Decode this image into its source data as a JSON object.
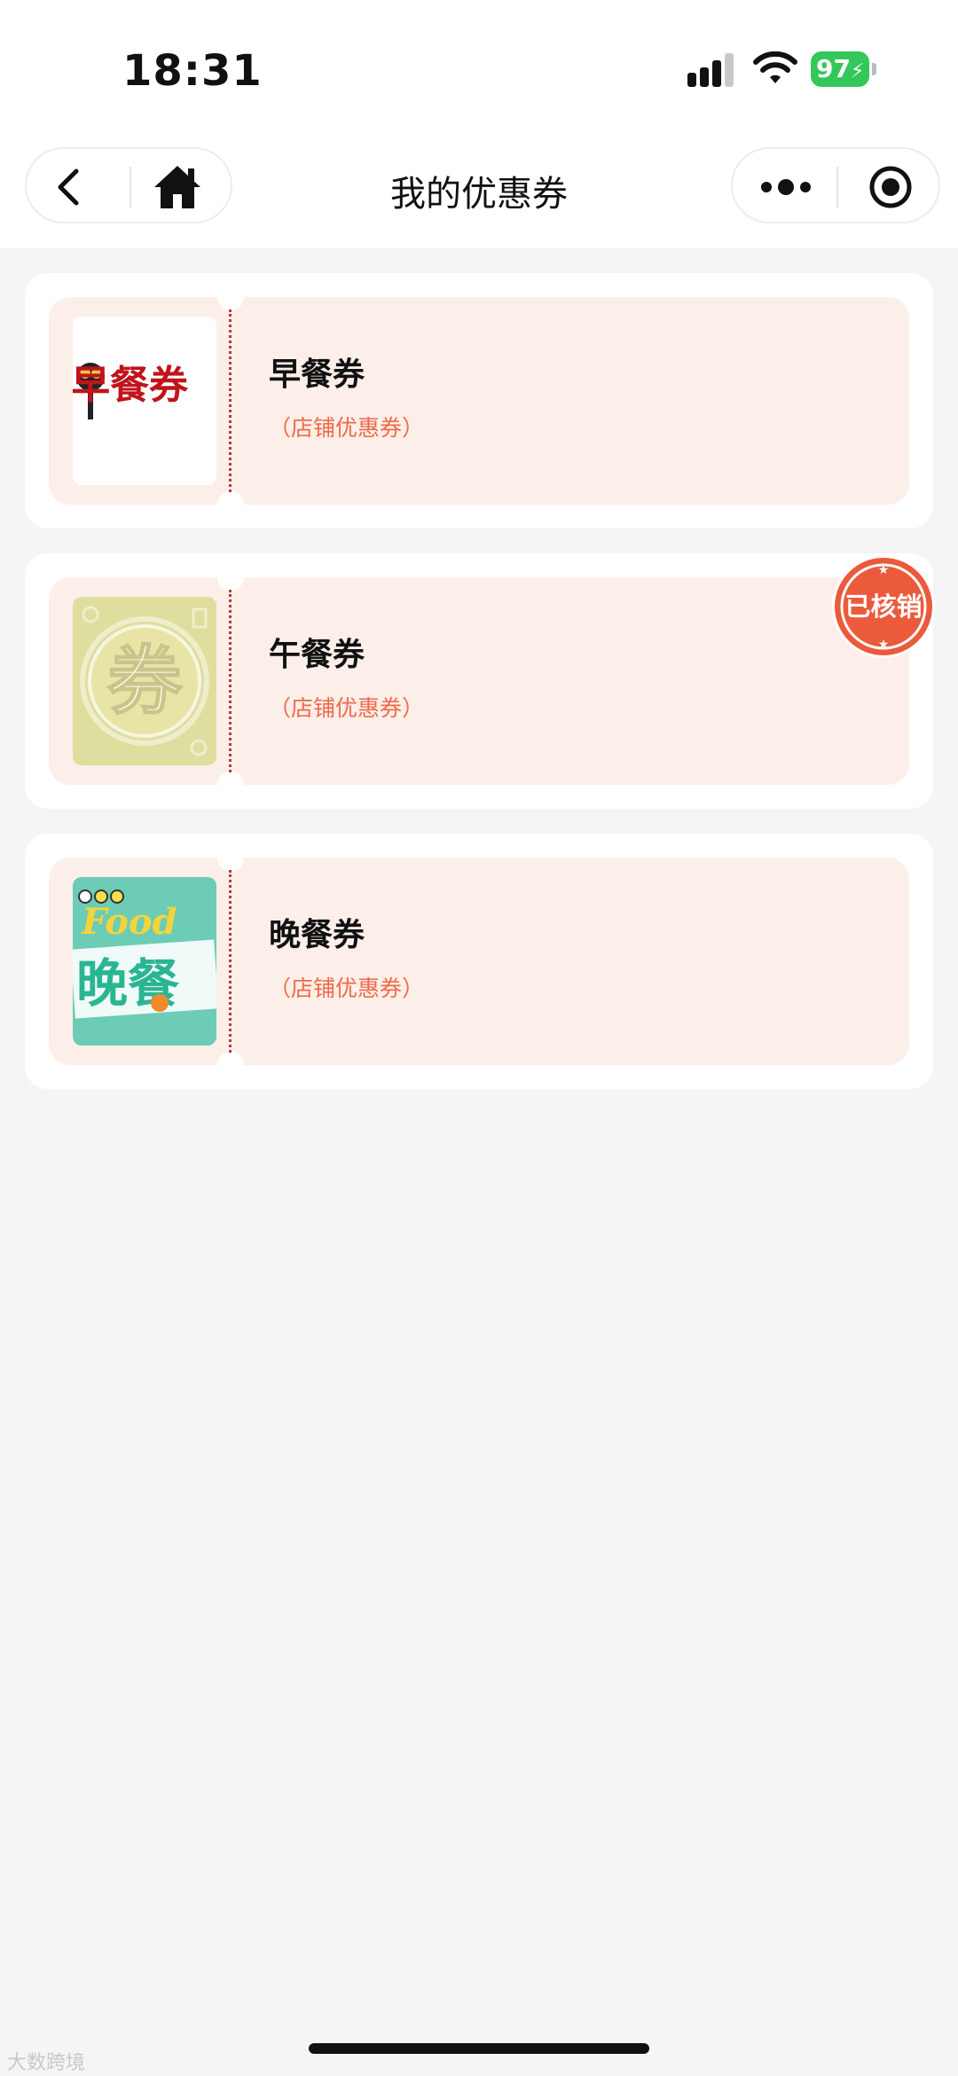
{
  "status_bar": {
    "time": "18:31",
    "battery": "97"
  },
  "navbar": {
    "title": "我的优惠券"
  },
  "coupons": [
    {
      "name": "早餐券",
      "type": "（店铺优惠券）",
      "image_text": "早餐券",
      "redeemed": false
    },
    {
      "name": "午餐券",
      "type": "（店铺优惠券）",
      "image_text": "券",
      "redeemed": true,
      "stamp": "已核销"
    },
    {
      "name": "晚餐券",
      "type": "（店铺优惠券）",
      "image_text": "Food 晚餐",
      "image_word": "Food",
      "image_title": "晚餐",
      "redeemed": false
    }
  ],
  "watermark": "大数跨境",
  "colors": {
    "ticket_bg": "#fcefe9",
    "accent": "#ee6a4a",
    "stamp": "#ec5a3c",
    "battery": "#34c759"
  }
}
